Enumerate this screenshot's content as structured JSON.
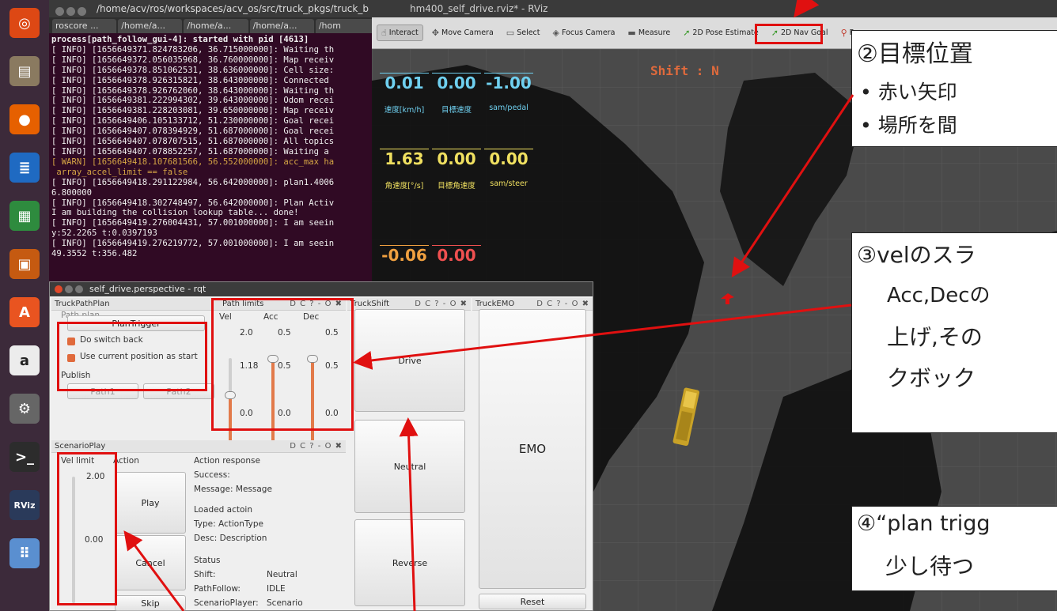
{
  "launcher": {
    "items": [
      {
        "icon": "ubuntu-logo-icon",
        "glyph": "◎",
        "bg": "#dd4814"
      },
      {
        "icon": "files-icon",
        "glyph": "▤",
        "bg": "#8a7a60"
      },
      {
        "icon": "firefox-icon",
        "glyph": "●",
        "bg": "#e66000"
      },
      {
        "icon": "writer-icon",
        "glyph": "≣",
        "bg": "#1f6ac2"
      },
      {
        "icon": "calc-icon",
        "glyph": "▦",
        "bg": "#2e8b3e"
      },
      {
        "icon": "impress-icon",
        "glyph": "▣",
        "bg": "#c55a11"
      },
      {
        "icon": "software-center-icon",
        "glyph": "A",
        "bg": "#e95420"
      },
      {
        "icon": "amazon-icon",
        "glyph": "a",
        "bg": "#ececec"
      },
      {
        "icon": "settings-icon",
        "glyph": "⚙",
        "bg": "#666"
      },
      {
        "icon": "terminal-icon",
        "glyph": ">_",
        "bg": "#2c2c2c"
      },
      {
        "icon": "rviz-icon",
        "glyph": "RViz",
        "bg": "#2a3a5a"
      },
      {
        "icon": "app-grid-icon",
        "glyph": "⠿",
        "bg": "#5a8fd0"
      }
    ]
  },
  "terminal": {
    "title": "/home/acv/ros/workspaces/acv_os/src/truck_pkgs/truck_b",
    "tabs": [
      "roscore ...",
      "/home/a...",
      "/home/a...",
      "/home/a...",
      "/hom"
    ],
    "lines": [
      {
        "text": "process[path_follow_gui-4]: started with pid [4613]",
        "cls": "bold"
      },
      {
        "text": "[ INFO] [1656649371.824783206, 36.715000000]: Waiting th",
        "cls": ""
      },
      {
        "text": "[ INFO] [1656649372.056035968, 36.760000000]: Map receiv",
        "cls": ""
      },
      {
        "text": "[ INFO] [1656649378.851062531, 38.636000000]: Cell size:",
        "cls": ""
      },
      {
        "text": "[ INFO] [1656649378.926315821, 38.643000000]: Connected",
        "cls": ""
      },
      {
        "text": "[ INFO] [1656649378.926762060, 38.643000000]: Waiting th",
        "cls": ""
      },
      {
        "text": "[ INFO] [1656649381.222994302, 39.643000000]: Odom recei",
        "cls": ""
      },
      {
        "text": "[ INFO] [1656649381.228203081, 39.650000000]: Map receiv",
        "cls": ""
      },
      {
        "text": "[ INFO] [1656649406.105133712, 51.230000000]: Goal recei",
        "cls": ""
      },
      {
        "text": "[ INFO] [1656649407.078394929, 51.687000000]: Goal recei",
        "cls": ""
      },
      {
        "text": "[ INFO] [1656649407.078707515, 51.687000000]: All topics",
        "cls": ""
      },
      {
        "text": "[ INFO] [1656649407.078852257, 51.687000000]: Waiting a",
        "cls": ""
      },
      {
        "text": "[ WARN] [1656649418.107681566, 56.552000000]: acc_max ha",
        "cls": "warn"
      },
      {
        "text": " array_accel_limit == false",
        "cls": "warn"
      },
      {
        "text": "[ INFO] [1656649418.291122984, 56.642000000]: plan1.4006",
        "cls": ""
      },
      {
        "text": "6.800000",
        "cls": ""
      },
      {
        "text": "[ INFO] [1656649418.302748497, 56.642000000]: Plan Activ",
        "cls": ""
      },
      {
        "text": "I am building the collision lookup table... done!",
        "cls": ""
      },
      {
        "text": "[ INFO] [1656649419.276004431, 57.001000000]: I am seein",
        "cls": ""
      },
      {
        "text": "y:52.2265 t:0.0397193",
        "cls": ""
      },
      {
        "text": "[ INFO] [1656649419.276219772, 57.001000000]: I am seein",
        "cls": ""
      },
      {
        "text": "49.3552 t:356.482",
        "cls": ""
      }
    ]
  },
  "rviz": {
    "title": "hm400_self_drive.rviz* - RViz",
    "tools": [
      {
        "label": "Interact",
        "icon": "interact-icon",
        "glyph": "☝"
      },
      {
        "label": "Move Camera",
        "icon": "move-camera-icon",
        "glyph": "✥"
      },
      {
        "label": "Select",
        "icon": "select-icon",
        "glyph": "▭"
      },
      {
        "label": "Focus Camera",
        "icon": "focus-camera-icon",
        "glyph": "◈"
      },
      {
        "label": "Measure",
        "icon": "measure-icon",
        "glyph": "▬"
      },
      {
        "label": "2D Pose Estimate",
        "icon": "pose-estimate-icon",
        "glyph": "➚"
      },
      {
        "label": "2D Nav Goal",
        "icon": "nav-goal-icon",
        "glyph": "➚"
      },
      {
        "label": "P",
        "icon": "publish-point-icon",
        "glyph": "⚲"
      }
    ],
    "shift_text": "Shift : N",
    "hud": [
      {
        "value": "0.01",
        "label": "速度[km/h]",
        "color": "#6fd0f0"
      },
      {
        "value": "0.00",
        "label": "目標速度",
        "color": "#6fd0f0"
      },
      {
        "value": "-1.00",
        "label": "sam/pedal",
        "color": "#6fd0f0"
      },
      {
        "value": "1.63",
        "label": "角速度[°/s]",
        "color": "#f0e060"
      },
      {
        "value": "0.00",
        "label": "目標角速度",
        "color": "#f0e060"
      },
      {
        "value": "0.00",
        "label": "sam/steer",
        "color": "#f0e060"
      },
      {
        "value": "-0.06",
        "label": "",
        "color": "#f0a040"
      },
      {
        "value": "0.00",
        "label": "",
        "color": "#f05050"
      }
    ]
  },
  "rqt": {
    "title": "self_drive.perspective - rqt",
    "truck_path_plan": {
      "header": "TruckPathPlan",
      "controls": "D C ? - O ✖",
      "path_plan_label": "Path plan",
      "plan_trigger": "PlanTrigger",
      "do_switch_back": "Do switch back",
      "use_current_position": "Use current position as start",
      "publish_label": "Publish",
      "path1": "Path1",
      "path2": "Path2",
      "path_limits": {
        "title": "Path limits",
        "vel": {
          "label": "Vel",
          "max": "2.0",
          "value": "1.18",
          "min": "0.0",
          "fraction": 0.59
        },
        "acc": {
          "label": "Acc",
          "max": "0.5",
          "value": "0.5",
          "min": "0.0",
          "fraction": 1.0
        },
        "dec": {
          "label": "Dec",
          "max": "0.5",
          "value": "0.5",
          "min": "0.0",
          "fraction": 1.0
        }
      }
    },
    "truck_shift": {
      "header": "TruckShift",
      "controls": "D C ? - O ✖",
      "drive": "Drive",
      "neutral": "Neutral",
      "reverse": "Reverse"
    },
    "truck_emo": {
      "header": "TruckEMO",
      "controls": "D C ? - O ✖",
      "emo": "EMO",
      "reset": "Reset"
    },
    "scenario_play": {
      "header": "ScenarioPlay",
      "controls": "D C ? - O ✖",
      "vel_limit_label": "Vel limit",
      "action_label": "Action",
      "vel_max": "2.00",
      "vel_value": "0.00",
      "vel_min": "0.0",
      "play": "Play",
      "cancel": "Cancel",
      "skip": "Skip",
      "action_response": "Action response",
      "success": "Success:",
      "message": "Message:  Message",
      "loaded_action": "Loaded actoin",
      "type": "Type:  ActionType",
      "desc": "Desc:  Description",
      "status": "Status",
      "shift_key": "Shift:",
      "shift_val": "Neutral",
      "pathfollow_key": "PathFollow:",
      "pathfollow_val": "IDLE",
      "scenario_key": "ScenarioPlayer:",
      "scenario_val": "Scenario"
    }
  },
  "annotations": {
    "note2_title": "②目標位置",
    "note2_b1": "•   赤い矢印",
    "note2_b2": "•   場所を間",
    "note3_l1": "③velのスラ",
    "note3_l2": "Acc,Decの",
    "note3_l3": "上げ,その",
    "note3_l4": "クボック",
    "note4_l1": "④“plan trigg",
    "note4_l2": "少し待つ"
  },
  "colors": {
    "highlight": "#e01010",
    "terminal_bg": "#300a24",
    "slider": "#e27a4a"
  }
}
